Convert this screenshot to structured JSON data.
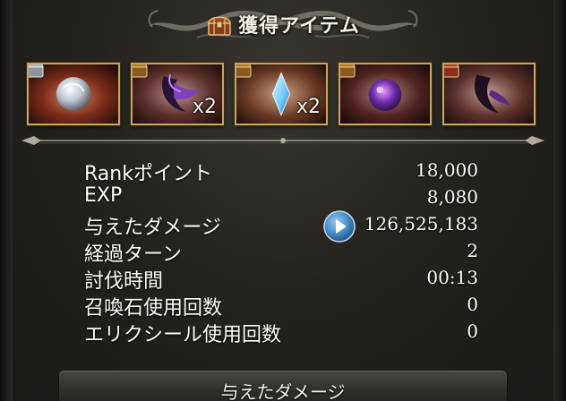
{
  "header": {
    "title": "獲得アイテム",
    "icon": "treasure-chest-icon"
  },
  "items": [
    {
      "name": "silver-orb-item",
      "quantity": "",
      "badge": "silver-chest-icon"
    },
    {
      "name": "purple-claw-item",
      "quantity": "x2",
      "badge": "gold-chest-icon"
    },
    {
      "name": "blue-crystal-item",
      "quantity": "x2",
      "badge": "gold-chest-icon"
    },
    {
      "name": "dark-orb-item",
      "quantity": "",
      "badge": "gold-chest-icon"
    },
    {
      "name": "dark-claw-item",
      "quantity": "",
      "badge": "red-chest-icon"
    }
  ],
  "stats": [
    {
      "label": "Rankポイント",
      "value": "18,000"
    },
    {
      "label": "EXP",
      "value": "8,080"
    },
    {
      "label": "与えたダメージ",
      "value": "126,525,183"
    },
    {
      "label": "経過ターン",
      "value": "2"
    },
    {
      "label": "討伐時間",
      "value": "00:13"
    },
    {
      "label": "召喚石使用回数",
      "value": "0"
    },
    {
      "label": "エリクシール使用回数",
      "value": "0"
    }
  ],
  "bottom_button": {
    "label": "与えたダメージ"
  },
  "colors": {
    "frame_gold": "#c6a463",
    "play_blue": "#3f86c2",
    "text": "#fdfbf5"
  }
}
